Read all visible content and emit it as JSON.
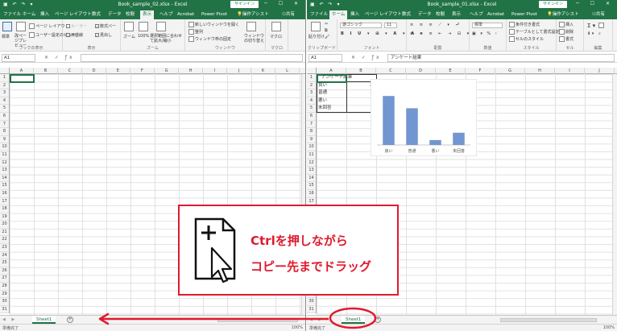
{
  "left_window": {
    "title": "Book_sample_02.xlsx - Excel",
    "signin": "サインイン",
    "share": "共有",
    "tabs": [
      "ファイル",
      "ホーム",
      "挿入",
      "ページ レイアウト",
      "数式",
      "データ",
      "校閲",
      "表示",
      "ヘルプ",
      "Acrobat",
      "Power Pivot",
      "操作アシスト"
    ],
    "active_tab": "表示",
    "ribbon": {
      "groups": [
        "ブックの表示",
        "表示",
        "ズーム",
        "ウィンドウ",
        "マクロ"
      ],
      "items": {
        "normal": "標準",
        "page_break": "改ページプレビュー",
        "page_layout": "ページ レイアウト",
        "custom_view": "ユーザー設定のビュー",
        "ruler": "ルーラー",
        "formula_bar": "数式バー",
        "gridlines": "目盛線",
        "headings": "見出し",
        "zoom": "ズーム",
        "zoom100": "100%",
        "zoom_selection": "選択範囲に合わせて拡大/縮小",
        "new_window": "新しいウィンドウを開く",
        "arrange": "整列",
        "freeze": "ウィンドウ枠の固定",
        "switch_window": "ウィンドウの切り替え",
        "macro": "マクロ"
      }
    },
    "name_box": "A1",
    "formula": "",
    "columns": [
      "A",
      "B",
      "C",
      "D",
      "E",
      "F",
      "G",
      "H",
      "I",
      "J",
      "K",
      "L"
    ],
    "rows": [
      "1",
      "2",
      "3",
      "4",
      "5",
      "6",
      "7",
      "8",
      "9",
      "10",
      "11",
      "12",
      "13",
      "14",
      "15",
      "16",
      "17",
      "18",
      "19",
      "20",
      "21",
      "22",
      "23",
      "24",
      "25",
      "26",
      "27",
      "28",
      "29",
      "30",
      "31"
    ],
    "sheet_tab": "Sheet1",
    "status": "準備完了",
    "zoom_level": "100%"
  },
  "right_window": {
    "title": "Book_sample_01.xlsx - Excel",
    "signin": "サインイン",
    "share": "共有",
    "tabs": [
      "ファイル",
      "ホーム",
      "挿入",
      "ページ レイアウト",
      "数式",
      "データ",
      "校閲",
      "表示",
      "ヘルプ",
      "Acrobat",
      "Power Pivot",
      "操作アシスト"
    ],
    "active_tab": "ホーム",
    "ribbon": {
      "groups": [
        "クリップボード",
        "フォント",
        "配置",
        "数値",
        "スタイル",
        "セル",
        "編集"
      ],
      "items": {
        "paste": "貼り付け",
        "font_name": "游ゴシック",
        "font_size": "11",
        "number_format": "標準",
        "conditional": "条件付き書式",
        "as_table": "テーブルとして書式設定",
        "cell_style": "セルのスタイル",
        "insert": "挿入",
        "delete": "削除",
        "format": "書式"
      }
    },
    "name_box": "A1",
    "formula": "アンケート結果",
    "columns": [
      "A",
      "B",
      "C",
      "D",
      "E",
      "F",
      "G",
      "H",
      "I",
      "J"
    ],
    "rows": [
      "1",
      "2",
      "3",
      "4",
      "5",
      "6",
      "7",
      "8",
      "9",
      "10",
      "11",
      "12",
      "13",
      "14",
      "15",
      "16",
      "17",
      "18",
      "19",
      "20",
      "21",
      "22",
      "23",
      "24",
      "25",
      "26",
      "27",
      "28",
      "29",
      "30",
      "31"
    ],
    "table": {
      "header": "アンケート結果",
      "rows": [
        {
          "label": "良い",
          "value": "20"
        },
        {
          "label": "普通",
          "value": "15"
        },
        {
          "label": "悪い",
          "value": "2"
        },
        {
          "label": "未回答",
          "value": "5"
        }
      ]
    },
    "sheet_tab": "Sheet1",
    "status": "準備完了",
    "zoom_level": "100%"
  },
  "chart_data": {
    "type": "bar",
    "categories": [
      "良い",
      "普通",
      "悪い",
      "未回答"
    ],
    "values": [
      20,
      15,
      2,
      5
    ],
    "title": "",
    "xlabel": "",
    "ylabel": "",
    "ylim": [
      0,
      25
    ],
    "grid": false,
    "bar_color": "#7296cf"
  },
  "callout": {
    "line1": "Ctrlを押しながら",
    "line2": "コピー先までドラッグ",
    "icon": "document-with-cursor-icon",
    "color": "#e01a2e"
  },
  "colors": {
    "excel_green": "#217346",
    "annotation_red": "#e01a2e"
  }
}
